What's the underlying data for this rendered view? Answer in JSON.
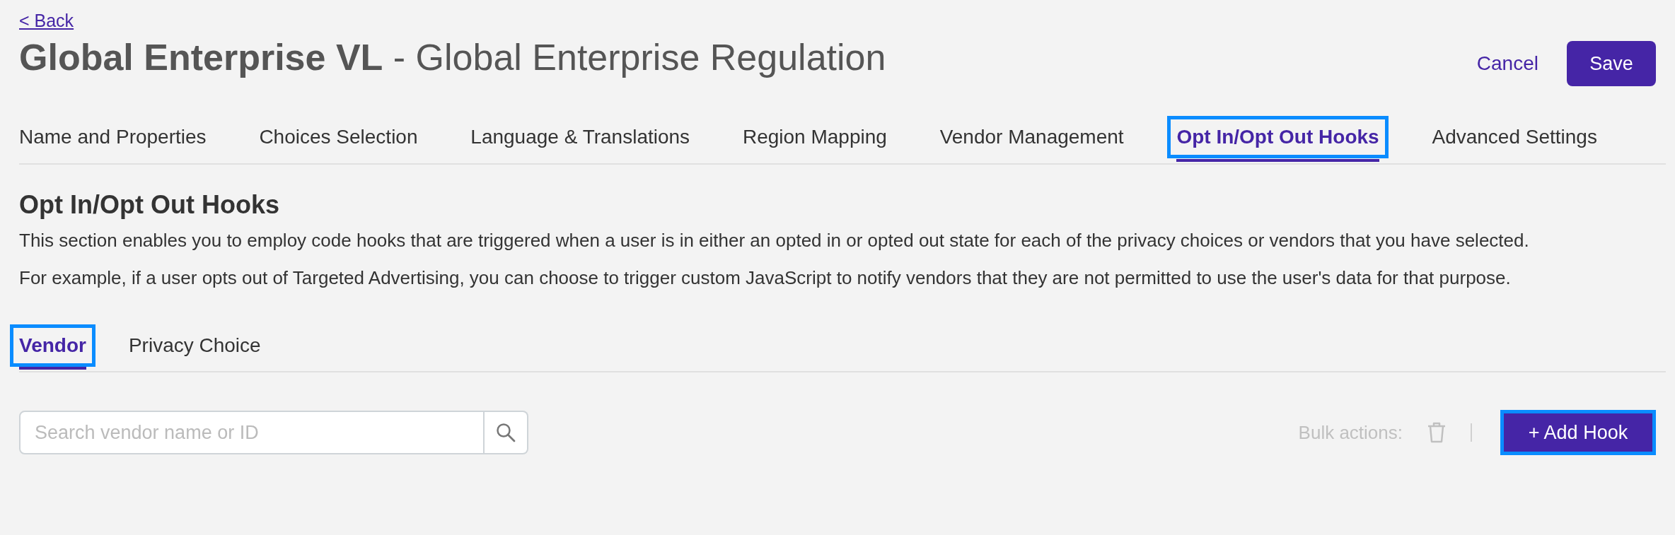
{
  "back_link": "< Back",
  "title": {
    "name": "Global Enterprise VL",
    "subtitle": "- Global Enterprise Regulation"
  },
  "header_actions": {
    "cancel": "Cancel",
    "save": "Save"
  },
  "tabs": [
    {
      "label": "Name and Properties",
      "selected": false,
      "highlighted": false
    },
    {
      "label": "Choices Selection",
      "selected": false,
      "highlighted": false
    },
    {
      "label": "Language & Translations",
      "selected": false,
      "highlighted": false
    },
    {
      "label": "Region Mapping",
      "selected": false,
      "highlighted": false
    },
    {
      "label": "Vendor Management",
      "selected": false,
      "highlighted": false
    },
    {
      "label": "Opt In/Opt Out Hooks",
      "selected": true,
      "highlighted": true
    },
    {
      "label": "Advanced Settings",
      "selected": false,
      "highlighted": false
    }
  ],
  "section": {
    "heading": "Opt In/Opt Out Hooks",
    "paragraphs": [
      "This section enables you to employ code hooks that are triggered when a user is in either an opted in or opted out state for each of the privacy choices or vendors that you have selected.",
      "For example, if a user opts out of Targeted Advertising, you can choose to trigger custom JavaScript to notify vendors that they are not permitted to use the user's data for that purpose."
    ]
  },
  "sub_tabs": [
    {
      "label": "Vendor",
      "selected": true,
      "highlighted": true
    },
    {
      "label": "Privacy Choice",
      "selected": false,
      "highlighted": false
    }
  ],
  "search": {
    "placeholder": "Search vendor name or ID"
  },
  "bulk_actions": {
    "label": "Bulk actions:"
  },
  "add_button": {
    "label": "+ Add Hook",
    "highlighted": true
  }
}
